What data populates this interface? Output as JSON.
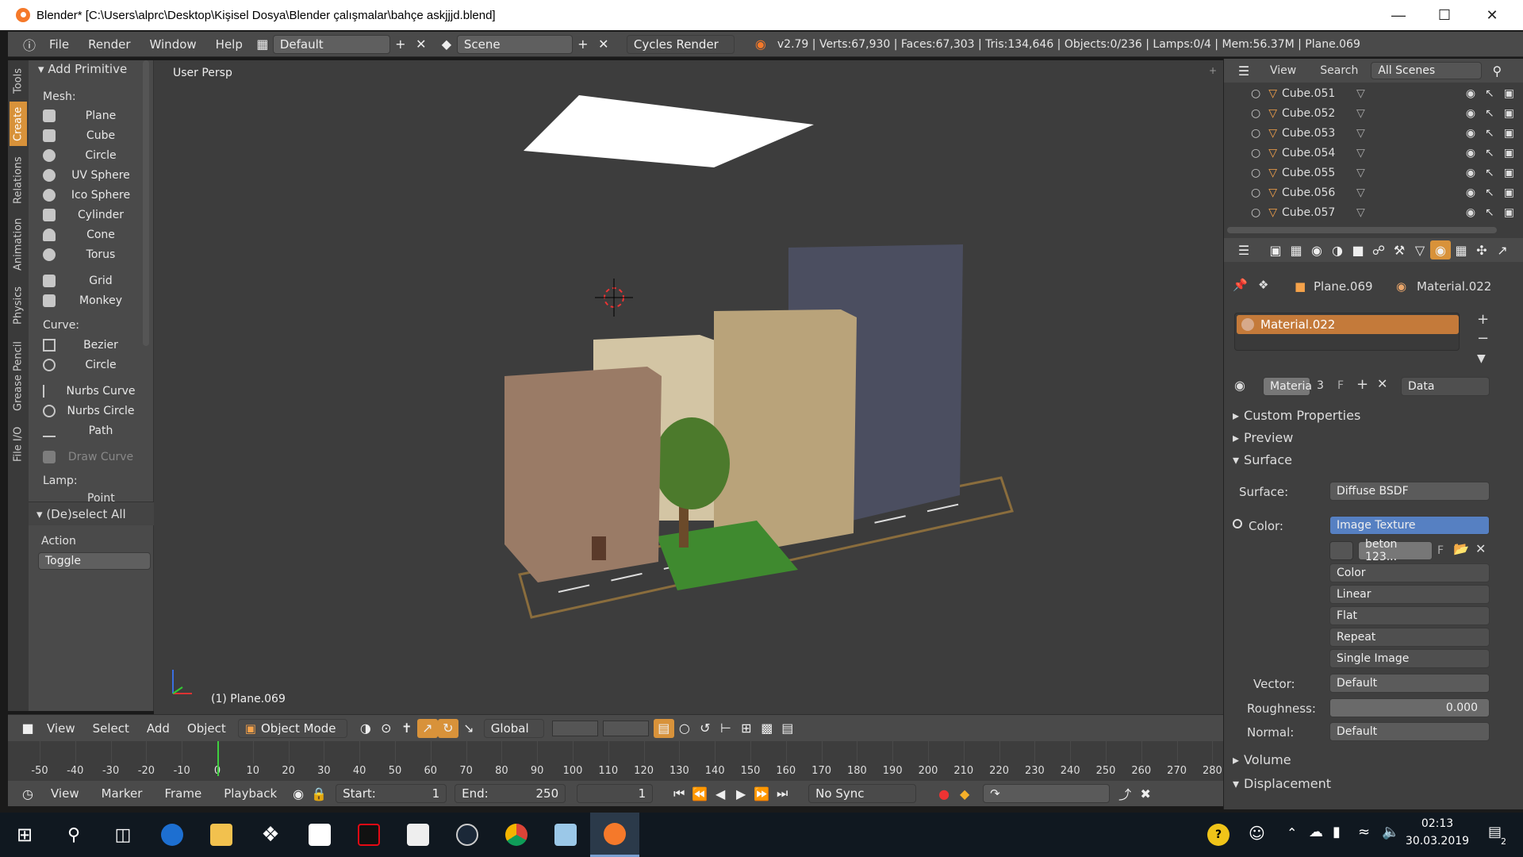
{
  "window": {
    "title": "Blender* [C:\\Users\\alprc\\Desktop\\Kişisel Dosya\\Blender çalışmalar\\bahçe askjjjd.blend]"
  },
  "menu": {
    "items": [
      "File",
      "Render",
      "Window",
      "Help"
    ],
    "layout": "Default",
    "scene": "Scene",
    "engine": "Cycles Render",
    "stats": "v2.79 | Verts:67,930 | Faces:67,303 | Tris:134,646 | Objects:0/236 | Lamps:0/4 | Mem:56.37M | Plane.069"
  },
  "tabs": [
    "Tools",
    "Create",
    "Relations",
    "Animation",
    "Physics",
    "Grease Pencil",
    "File I/O"
  ],
  "shelf": {
    "title": "Add Primitive",
    "mesh_label": "Mesh:",
    "mesh": [
      "Plane",
      "Cube",
      "Circle",
      "UV Sphere",
      "Ico Sphere",
      "Cylinder",
      "Cone",
      "Torus",
      "Grid",
      "Monkey"
    ],
    "curve_label": "Curve:",
    "curve": [
      "Bezier",
      "Circle",
      "Nurbs Curve",
      "Nurbs Circle",
      "Path"
    ],
    "draw_curve": "Draw Curve",
    "lamp_label": "Lamp:",
    "lamp_partial": "Point",
    "deselect": "(De)select All",
    "action_label": "Action",
    "action_value": "Toggle"
  },
  "viewport": {
    "label": "User Persp",
    "object": "(1) Plane.069"
  },
  "vpheader": {
    "items": [
      "View",
      "Select",
      "Add",
      "Object"
    ],
    "mode": "Object Mode",
    "orientation": "Global"
  },
  "timeline": {
    "ticks": [
      "-50",
      "-40",
      "-30",
      "-20",
      "-10",
      "0",
      "10",
      "20",
      "30",
      "40",
      "50",
      "60",
      "70",
      "80",
      "90",
      "100",
      "110",
      "120",
      "130",
      "140",
      "150",
      "160",
      "170",
      "180",
      "190",
      "200",
      "210",
      "220",
      "230",
      "240",
      "250",
      "260",
      "270",
      "280"
    ],
    "current_frame_value": 0
  },
  "tlbar": {
    "items": [
      "View",
      "Marker",
      "Frame",
      "Playback"
    ],
    "start_label": "Start:",
    "start": "1",
    "end_label": "End:",
    "end": "250",
    "frame": "1",
    "sync": "No Sync"
  },
  "outliner": {
    "menu": [
      "View",
      "Search"
    ],
    "scenes": "All Scenes",
    "rows": [
      "Cube.051",
      "Cube.052",
      "Cube.053",
      "Cube.054",
      "Cube.055",
      "Cube.056",
      "Cube.057"
    ]
  },
  "props": {
    "object": "Plane.069",
    "material": "Material.022",
    "slot": "Material.022",
    "mat_field": "Materia",
    "users": "3",
    "fake": "F",
    "link": "Data",
    "panels": [
      "Custom Properties",
      "Preview",
      "Surface"
    ],
    "surface_label": "Surface:",
    "surface_value": "Diffuse BSDF",
    "color_label": "Color:",
    "color_value": "Image Texture",
    "image_name": "beton 123...",
    "image_f": "F",
    "tex_opts": [
      "Color",
      "Linear",
      "Flat",
      "Repeat",
      "Single Image"
    ],
    "vector_label": "Vector:",
    "vector_value": "Default",
    "roughness_label": "Roughness:",
    "roughness_value": "0.000",
    "normal_label": "Normal:",
    "normal_value": "Default",
    "volume": "Volume",
    "displacement": "Displacement"
  },
  "taskbar": {
    "time": "02:13",
    "date": "30.03.2019",
    "notif": "2"
  },
  "colors": {
    "accent": "#f5792a",
    "active_tab": "#d8923a",
    "select_blue": "#5680c2"
  }
}
